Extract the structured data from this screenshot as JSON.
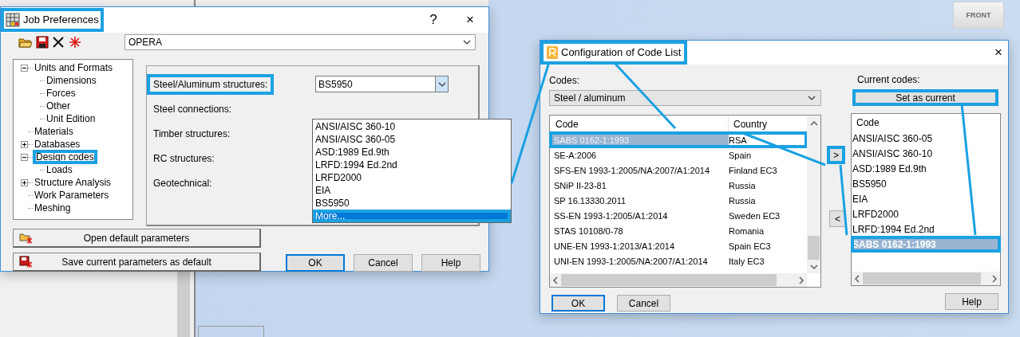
{
  "view_cube": {
    "label": "FRONT"
  },
  "job_window": {
    "title": "Job Preferences",
    "title_highlighted": true,
    "help_glyph": "?",
    "close_glyph": "×",
    "preset": "OPERA",
    "tree": [
      {
        "label": "Units and Formats",
        "expanded": true,
        "highlighted": false,
        "children": [
          {
            "label": "Dimensions"
          },
          {
            "label": "Forces"
          },
          {
            "label": "Other"
          },
          {
            "label": "Unit Edition"
          }
        ]
      },
      {
        "label": "Materials",
        "highlighted": false
      },
      {
        "label": "Databases",
        "expanded": false,
        "highlighted": false
      },
      {
        "label": "Design codes",
        "expanded": true,
        "highlighted": true,
        "children": [
          {
            "label": "Loads"
          }
        ]
      },
      {
        "label": "Structure Analysis",
        "expanded": false,
        "highlighted": false
      },
      {
        "label": "Work Parameters",
        "highlighted": false
      },
      {
        "label": "Meshing",
        "highlighted": false
      }
    ],
    "fields": [
      {
        "label": "Steel/Aluminum structures:",
        "highlighted": true,
        "value": "BS5950"
      },
      {
        "label": "Steel connections:",
        "highlighted": false
      },
      {
        "label": "Timber structures:",
        "highlighted": false
      },
      {
        "label": "RC structures:",
        "highlighted": false
      },
      {
        "label": "Geotechnical:",
        "highlighted": false
      }
    ],
    "dropdown_items": [
      {
        "label": "ANSI/AISC 360-10",
        "selected": false,
        "highlighted": false
      },
      {
        "label": "ANSI/AISC 360-05",
        "selected": false,
        "highlighted": false
      },
      {
        "label": "ASD:1989 Ed.9th",
        "selected": false,
        "highlighted": false
      },
      {
        "label": "LRFD:1994 Ed.2nd",
        "selected": false,
        "highlighted": false
      },
      {
        "label": "LRFD2000",
        "selected": false,
        "highlighted": false
      },
      {
        "label": "EIA",
        "selected": false,
        "highlighted": false
      },
      {
        "label": "BS5950",
        "selected": false,
        "highlighted": false
      },
      {
        "label": "More...",
        "selected": true,
        "highlighted": true
      }
    ],
    "parameter_buttons": [
      {
        "kind": "open",
        "label": "Open default parameters"
      },
      {
        "kind": "save",
        "label": "Save current parameters as default"
      }
    ],
    "buttons": [
      {
        "label": "OK",
        "default": true
      },
      {
        "label": "Cancel",
        "default": false
      },
      {
        "label": "Help",
        "default": false
      }
    ]
  },
  "config_window": {
    "title": "Configuration of Code List",
    "title_highlighted": true,
    "close_glyph": "×",
    "codes_label": "Codes:",
    "codes_value": "Steel / aluminum",
    "codes_table": {
      "columns": [
        "Code",
        "Country"
      ],
      "rows": [
        {
          "code": "SABS 0162-1:1993",
          "country": "RSA",
          "selected": true,
          "highlighted": true
        },
        {
          "code": "SE-A:2006",
          "country": "Spain",
          "selected": false,
          "highlighted": false
        },
        {
          "code": "SFS-EN 1993-1:2005/NA:2007/A1:2014",
          "country": "Finland EC3",
          "selected": false,
          "highlighted": false
        },
        {
          "code": "SNiP II-23-81",
          "country": "Russia",
          "selected": false,
          "highlighted": false
        },
        {
          "code": "SP 16.13330.2011",
          "country": "Russia",
          "selected": false,
          "highlighted": false
        },
        {
          "code": "SS-EN 1993-1:2005/A1:2014",
          "country": "Sweden EC3",
          "selected": false,
          "highlighted": false
        },
        {
          "code": "STAS 10108/0-78",
          "country": "Romania",
          "selected": false,
          "highlighted": false
        },
        {
          "code": "UNE-EN 1993-1:2013/A1:2014",
          "country": "Spain EC3",
          "selected": false,
          "highlighted": false
        },
        {
          "code": "UNI-EN 1993-1:2005/NA:2007/A1:2014",
          "country": "Italy EC3",
          "selected": false,
          "highlighted": false
        }
      ]
    },
    "move_buttons": [
      {
        "label": ">",
        "highlighted": true
      },
      {
        "label": "<",
        "highlighted": false
      }
    ],
    "current_label": "Current codes:",
    "set_current": {
      "label": "Set as current",
      "highlighted": true
    },
    "current_list": {
      "column": "Code",
      "items": [
        {
          "label": "ANSI/AISC 360-05",
          "selected": false,
          "highlighted": false
        },
        {
          "label": "ANSI/AISC 360-10",
          "selected": false,
          "highlighted": false
        },
        {
          "label": "ASD:1989 Ed.9th",
          "selected": false,
          "highlighted": false
        },
        {
          "label": "BS5950",
          "selected": false,
          "highlighted": false
        },
        {
          "label": "EIA",
          "selected": false,
          "highlighted": false
        },
        {
          "label": "LRFD2000",
          "selected": false,
          "highlighted": false
        },
        {
          "label": "LRFD:1994 Ed.2nd",
          "selected": false,
          "highlighted": false
        },
        {
          "label": "SABS 0162-1:1993",
          "selected": true,
          "highlighted": true
        }
      ]
    },
    "buttons": [
      {
        "label": "OK",
        "default": true
      },
      {
        "label": "Cancel",
        "default": false
      }
    ],
    "help_button": {
      "label": "Help",
      "default": false
    }
  }
}
